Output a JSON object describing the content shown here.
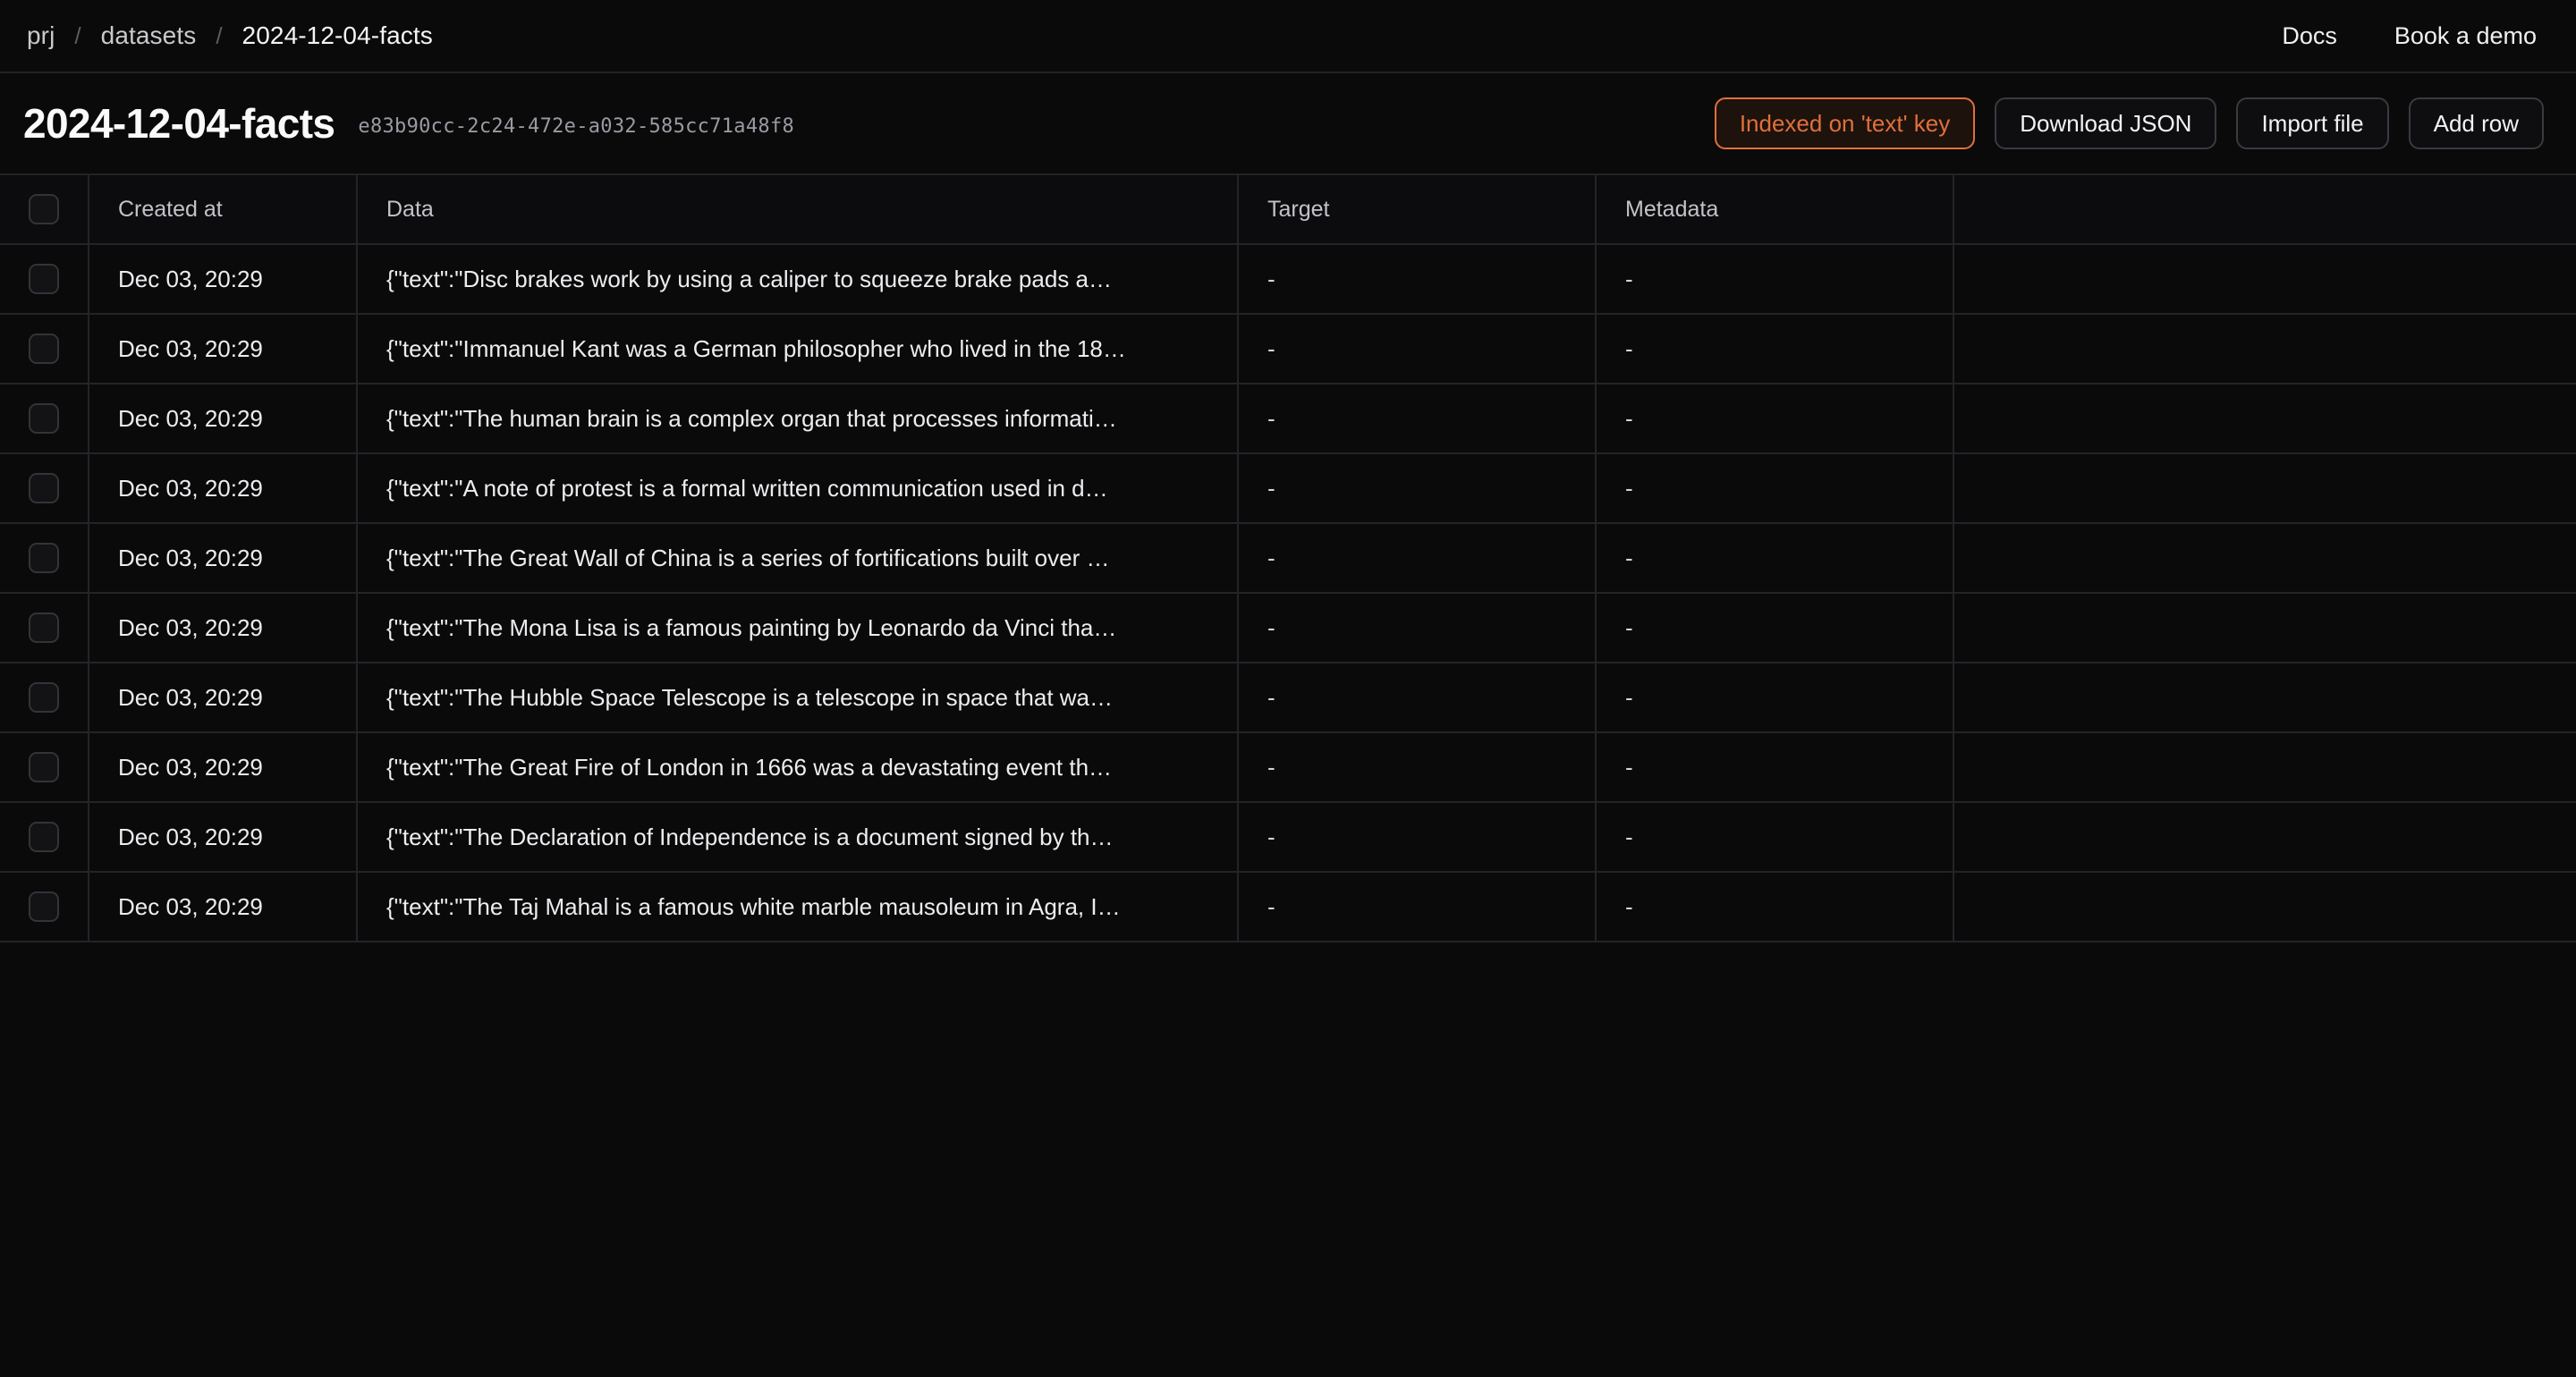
{
  "topbar": {
    "breadcrumb": {
      "separator": "/",
      "items": [
        {
          "label": "prj",
          "current": false
        },
        {
          "label": "datasets",
          "current": false
        },
        {
          "label": "2024-12-04-facts",
          "current": true
        }
      ]
    },
    "nav": [
      {
        "label": "Docs"
      },
      {
        "label": "Book a demo"
      }
    ]
  },
  "header": {
    "title": "2024-12-04-facts",
    "uuid": "e83b90cc-2c24-472e-a032-585cc71a48f8",
    "actions": [
      {
        "label": "Indexed on 'text' key",
        "style": "badge",
        "color": "#e0703c"
      },
      {
        "label": "Download JSON",
        "style": "default"
      },
      {
        "label": "Import file",
        "style": "default"
      },
      {
        "label": "Add row",
        "style": "default"
      }
    ]
  },
  "table": {
    "columns": [
      {
        "key": "select",
        "label": ""
      },
      {
        "key": "created_at",
        "label": "Created at"
      },
      {
        "key": "data",
        "label": "Data"
      },
      {
        "key": "target",
        "label": "Target"
      },
      {
        "key": "metadata",
        "label": "Metadata"
      }
    ],
    "empty_value": "-",
    "rows": [
      {
        "created_at": "Dec 03, 20:29",
        "data": "{\"text\":\"Disc brakes work by using a caliper to squeeze brake pads a…",
        "target": "-",
        "metadata": "-"
      },
      {
        "created_at": "Dec 03, 20:29",
        "data": "{\"text\":\"Immanuel Kant was a German philosopher who lived in the 18…",
        "target": "-",
        "metadata": "-"
      },
      {
        "created_at": "Dec 03, 20:29",
        "data": "{\"text\":\"The human brain is a complex organ that processes informati…",
        "target": "-",
        "metadata": "-"
      },
      {
        "created_at": "Dec 03, 20:29",
        "data": "{\"text\":\"A note of protest is a formal written communication used in d…",
        "target": "-",
        "metadata": "-"
      },
      {
        "created_at": "Dec 03, 20:29",
        "data": "{\"text\":\"The Great Wall of China is a series of fortifications built over …",
        "target": "-",
        "metadata": "-"
      },
      {
        "created_at": "Dec 03, 20:29",
        "data": "{\"text\":\"The Mona Lisa is a famous painting by Leonardo da Vinci tha…",
        "target": "-",
        "metadata": "-"
      },
      {
        "created_at": "Dec 03, 20:29",
        "data": "{\"text\":\"The Hubble Space Telescope is a telescope in space that wa…",
        "target": "-",
        "metadata": "-"
      },
      {
        "created_at": "Dec 03, 20:29",
        "data": "{\"text\":\"The Great Fire of London in 1666 was a devastating event th…",
        "target": "-",
        "metadata": "-"
      },
      {
        "created_at": "Dec 03, 20:29",
        "data": "{\"text\":\"The Declaration of Independence is a document signed by th…",
        "target": "-",
        "metadata": "-"
      },
      {
        "created_at": "Dec 03, 20:29",
        "data": "{\"text\":\"The Taj Mahal is a famous white marble mausoleum in Agra, I…",
        "target": "-",
        "metadata": "-"
      }
    ]
  }
}
